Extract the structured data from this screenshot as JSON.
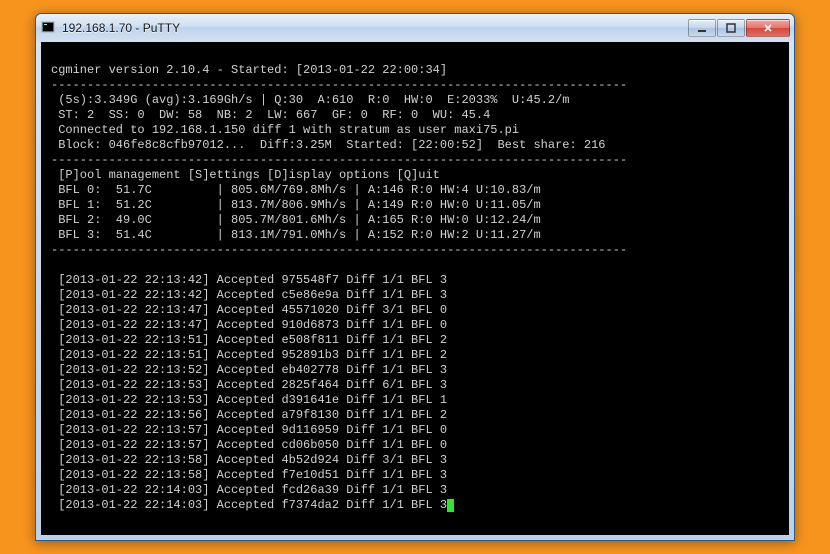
{
  "window": {
    "title": "192.168.1.70 - PuTTY"
  },
  "terminal": {
    "header": "cgminer version 2.10.4 - Started: [2013-01-22 22:00:34]",
    "sep": "--------------------------------------------------------------------------------",
    "stats1": " (5s):3.349G (avg):3.169Gh/s | Q:30  A:610  R:0  HW:0  E:2033%  U:45.2/m",
    "stats2": " ST: 2  SS: 0  DW: 58  NB: 2  LW: 667  GF: 0  RF: 0  WU: 45.4",
    "conn": " Connected to 192.168.1.150 diff 1 with stratum as user maxi75.pi",
    "block": " Block: 046fe8c8cfb97012...  Diff:3.25M  Started: [22:00:52]  Best share: 216",
    "menu": " [P]ool management [S]ettings [D]isplay options [Q]uit",
    "devs": [
      " BFL 0:  51.7C         | 805.6M/769.8Mh/s | A:146 R:0 HW:4 U:10.83/m",
      " BFL 1:  51.2C         | 813.7M/806.9Mh/s | A:149 R:0 HW:0 U:11.05/m",
      " BFL 2:  49.0C         | 805.7M/801.6Mh/s | A:165 R:0 HW:0 U:12.24/m",
      " BFL 3:  51.4C         | 813.1M/791.0Mh/s | A:152 R:0 HW:2 U:11.27/m"
    ],
    "log": [
      " [2013-01-22 22:13:42] Accepted 975548f7 Diff 1/1 BFL 3",
      " [2013-01-22 22:13:42] Accepted c5e86e9a Diff 1/1 BFL 3",
      " [2013-01-22 22:13:47] Accepted 45571020 Diff 3/1 BFL 0",
      " [2013-01-22 22:13:47] Accepted 910d6873 Diff 1/1 BFL 0",
      " [2013-01-22 22:13:51] Accepted e508f811 Diff 1/1 BFL 2",
      " [2013-01-22 22:13:51] Accepted 952891b3 Diff 1/1 BFL 2",
      " [2013-01-22 22:13:52] Accepted eb402778 Diff 1/1 BFL 3",
      " [2013-01-22 22:13:53] Accepted 2825f464 Diff 6/1 BFL 3",
      " [2013-01-22 22:13:53] Accepted d391641e Diff 1/1 BFL 1",
      " [2013-01-22 22:13:56] Accepted a79f8130 Diff 1/1 BFL 2",
      " [2013-01-22 22:13:57] Accepted 9d116959 Diff 1/1 BFL 0",
      " [2013-01-22 22:13:57] Accepted cd06b050 Diff 1/1 BFL 0",
      " [2013-01-22 22:13:58] Accepted 4b52d924 Diff 3/1 BFL 3",
      " [2013-01-22 22:13:58] Accepted f7e10d51 Diff 1/1 BFL 3",
      " [2013-01-22 22:14:03] Accepted fcd26a39 Diff 1/1 BFL 3",
      " [2013-01-22 22:14:03] Accepted f7374da2 Diff 1/1 BFL 3"
    ]
  }
}
